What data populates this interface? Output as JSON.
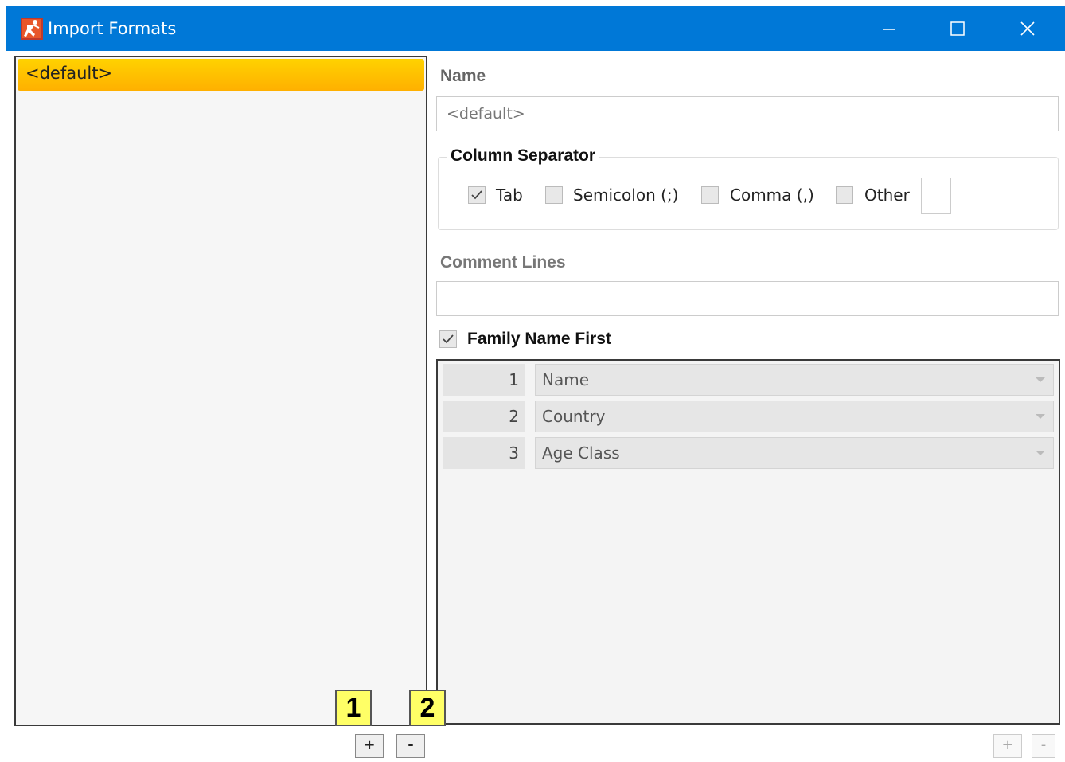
{
  "window": {
    "title": "Import Formats",
    "minimize_glyph": "—",
    "maximize_glyph": "☐",
    "close_glyph": "✕"
  },
  "formats_list": {
    "items": [
      {
        "label": "<default>",
        "selected": true
      }
    ]
  },
  "name": {
    "label": "Name",
    "value": "<default>"
  },
  "column_separator": {
    "label": "Column Separator",
    "options": [
      {
        "label": "Tab",
        "checked": true
      },
      {
        "label": "Semicolon (;)",
        "checked": false
      },
      {
        "label": "Comma (,)",
        "checked": false
      },
      {
        "label": "Other",
        "checked": false
      }
    ],
    "other_value": ""
  },
  "comment_lines": {
    "label": "Comment Lines",
    "value": ""
  },
  "family_name_first": {
    "label": "Family Name First",
    "checked": true
  },
  "columns": [
    {
      "number": "1",
      "field": "Name"
    },
    {
      "number": "2",
      "field": "Country"
    },
    {
      "number": "3",
      "field": "Age Class"
    }
  ],
  "buttons": {
    "add": "+",
    "remove": "-"
  },
  "callouts": {
    "add": "1",
    "remove": "2"
  },
  "colors": {
    "titlebar": "#0078d7",
    "selection": "#ffc000",
    "callout": "#ffff66"
  },
  "icons": {
    "app": "runner-icon",
    "check": "checkmark-icon",
    "dropdown": "chevron-down-icon"
  }
}
